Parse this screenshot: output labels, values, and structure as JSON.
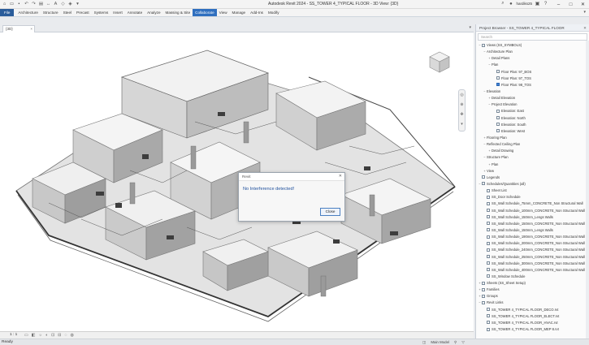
{
  "app": {
    "title": "Autodesk Revit 2024 - SS_TOWER 4_TYPICAL FLOOR - 3D View: {3D}",
    "user": "hardiks25"
  },
  "qat_icons": [
    "home-icon",
    "open-icon",
    "save-icon",
    "undo-icon",
    "redo-icon",
    "print-icon",
    "measure-icon",
    "text-icon",
    "3d-view-icon",
    "section-icon",
    "close-hidden-icon"
  ],
  "ribbon": {
    "tabs": [
      "File",
      "Architecture",
      "Structure",
      "Steel",
      "Precast",
      "Systems",
      "Insert",
      "Annotate",
      "Analyze",
      "Massing & Site",
      "Collaborate",
      "View",
      "Manage",
      "Add-Ins",
      "Modify"
    ],
    "active": "Collaborate"
  },
  "view_tab": {
    "label": "{3D}"
  },
  "dialog": {
    "title": "Revit",
    "message": "No Interference detected!",
    "close_label": "Close"
  },
  "view_bar": {
    "scale": "1 : 1"
  },
  "status": {
    "text": "Ready",
    "main_model": "Main Model"
  },
  "browser": {
    "title": "Project Browser - SS_TOWER 4_TYPICAL FLOOR",
    "search_placeholder": "Search",
    "items": [
      {
        "label": "Views (SS_SYMBOLS)",
        "level": 0,
        "toggle": "-",
        "icon": true
      },
      {
        "label": "Architecture Plan",
        "level": 1,
        "toggle": "-"
      },
      {
        "label": "Detail Plans",
        "level": 2,
        "toggle": "+"
      },
      {
        "label": "Plan",
        "level": 2,
        "toggle": "-"
      },
      {
        "label": "Floor Plan: 97_BOS",
        "level": 3,
        "toggle": "",
        "icon": true
      },
      {
        "label": "Floor Plan: 97_TOS",
        "level": 3,
        "toggle": "",
        "icon": true
      },
      {
        "label": "Floor Plan: 98_TOS",
        "level": 3,
        "toggle": "",
        "icon": true,
        "selected": true
      },
      {
        "label": "Elevation",
        "level": 1,
        "toggle": "-"
      },
      {
        "label": "Detail Elevation",
        "level": 2,
        "toggle": "+"
      },
      {
        "label": "Project Elevation",
        "level": 2,
        "toggle": "-"
      },
      {
        "label": "Elevation: East",
        "level": 3,
        "toggle": "",
        "icon": true
      },
      {
        "label": "Elevation: North",
        "level": 3,
        "toggle": "",
        "icon": true
      },
      {
        "label": "Elevation: South",
        "level": 3,
        "toggle": "",
        "icon": true
      },
      {
        "label": "Elevation: West",
        "level": 3,
        "toggle": "",
        "icon": true
      },
      {
        "label": "Flooring Plan",
        "level": 1,
        "toggle": "+"
      },
      {
        "label": "Reflected Ceiling Plan",
        "level": 1,
        "toggle": "-"
      },
      {
        "label": "Detail Drawing",
        "level": 2,
        "toggle": "+"
      },
      {
        "label": "Structure Plan",
        "level": 1,
        "toggle": "-"
      },
      {
        "label": "Plan",
        "level": 2,
        "toggle": "+"
      },
      {
        "label": "View",
        "level": 1,
        "toggle": "+"
      },
      {
        "label": "Legends",
        "level": 0,
        "toggle": "",
        "icon": true
      },
      {
        "label": "Schedules/Quantities (all)",
        "level": 0,
        "toggle": "-",
        "icon": true
      },
      {
        "label": "Sheet List",
        "level": 1,
        "toggle": "",
        "icon": true
      },
      {
        "label": "SS_Door Schedule",
        "level": 1,
        "toggle": "",
        "icon": true
      },
      {
        "label": "SS_Wall Schedule_75mm_CONCRETE_Non Structural Wall",
        "level": 1,
        "toggle": "",
        "icon": true
      },
      {
        "label": "SS_Wall Schedule_100mm_CONCRETE_Non Structural Wall",
        "level": 1,
        "toggle": "",
        "icon": true
      },
      {
        "label": "SS_Wall Schedule_150mm_Lengs Walls",
        "level": 1,
        "toggle": "",
        "icon": true
      },
      {
        "label": "SS_Wall Schedule_150mm_CONCRETE_Non Structural Wall",
        "level": 1,
        "toggle": "",
        "icon": true
      },
      {
        "label": "SS_Wall Schedule_150mm_Lengs Walls",
        "level": 1,
        "toggle": "",
        "icon": true
      },
      {
        "label": "SS_Wall Schedule_190mm_CONCRETE_Non Structural Wall",
        "level": 1,
        "toggle": "",
        "icon": true
      },
      {
        "label": "SS_Wall Schedule_200mm_CONCRETE_Non Structural Wall",
        "level": 1,
        "toggle": "",
        "icon": true
      },
      {
        "label": "SS_Wall Schedule_240mm_CONCRETE_Non Structural Wall",
        "level": 1,
        "toggle": "",
        "icon": true
      },
      {
        "label": "SS_Wall Schedule_250mm_CONCRETE_Non Structural Wall",
        "level": 1,
        "toggle": "",
        "icon": true
      },
      {
        "label": "SS_Wall Schedule_300mm_CONCRETE_Non Structural Wall",
        "level": 1,
        "toggle": "",
        "icon": true
      },
      {
        "label": "SS_Wall Schedule_400mm_CONCRETE_Non Structural Wall",
        "level": 1,
        "toggle": "",
        "icon": true
      },
      {
        "label": "SS_Window Schedule",
        "level": 1,
        "toggle": "",
        "icon": true
      },
      {
        "label": "Sheets (SS_Sheet Setup)",
        "level": 0,
        "toggle": "+",
        "icon": true
      },
      {
        "label": "Families",
        "level": 0,
        "toggle": "+",
        "icon": true
      },
      {
        "label": "Groups",
        "level": 0,
        "toggle": "+",
        "icon": true
      },
      {
        "label": "Revit Links",
        "level": 0,
        "toggle": "-",
        "icon": true
      },
      {
        "label": "SS_TOWER 4_TYPICAL FLOOR_DECO.rvt",
        "level": 1,
        "toggle": "",
        "icon": true
      },
      {
        "label": "SS_TOWER 4_TYPICAL FLOOR_ELECT.rvt",
        "level": 1,
        "toggle": "",
        "icon": true
      },
      {
        "label": "SS_TOWER 4_TYPICAL FLOOR_HVAC.rvt",
        "level": 1,
        "toggle": "",
        "icon": true
      },
      {
        "label": "SS_TOWER 4_TYPICAL FLOOR_MEP 8.rvt",
        "level": 1,
        "toggle": "",
        "icon": true
      }
    ]
  }
}
